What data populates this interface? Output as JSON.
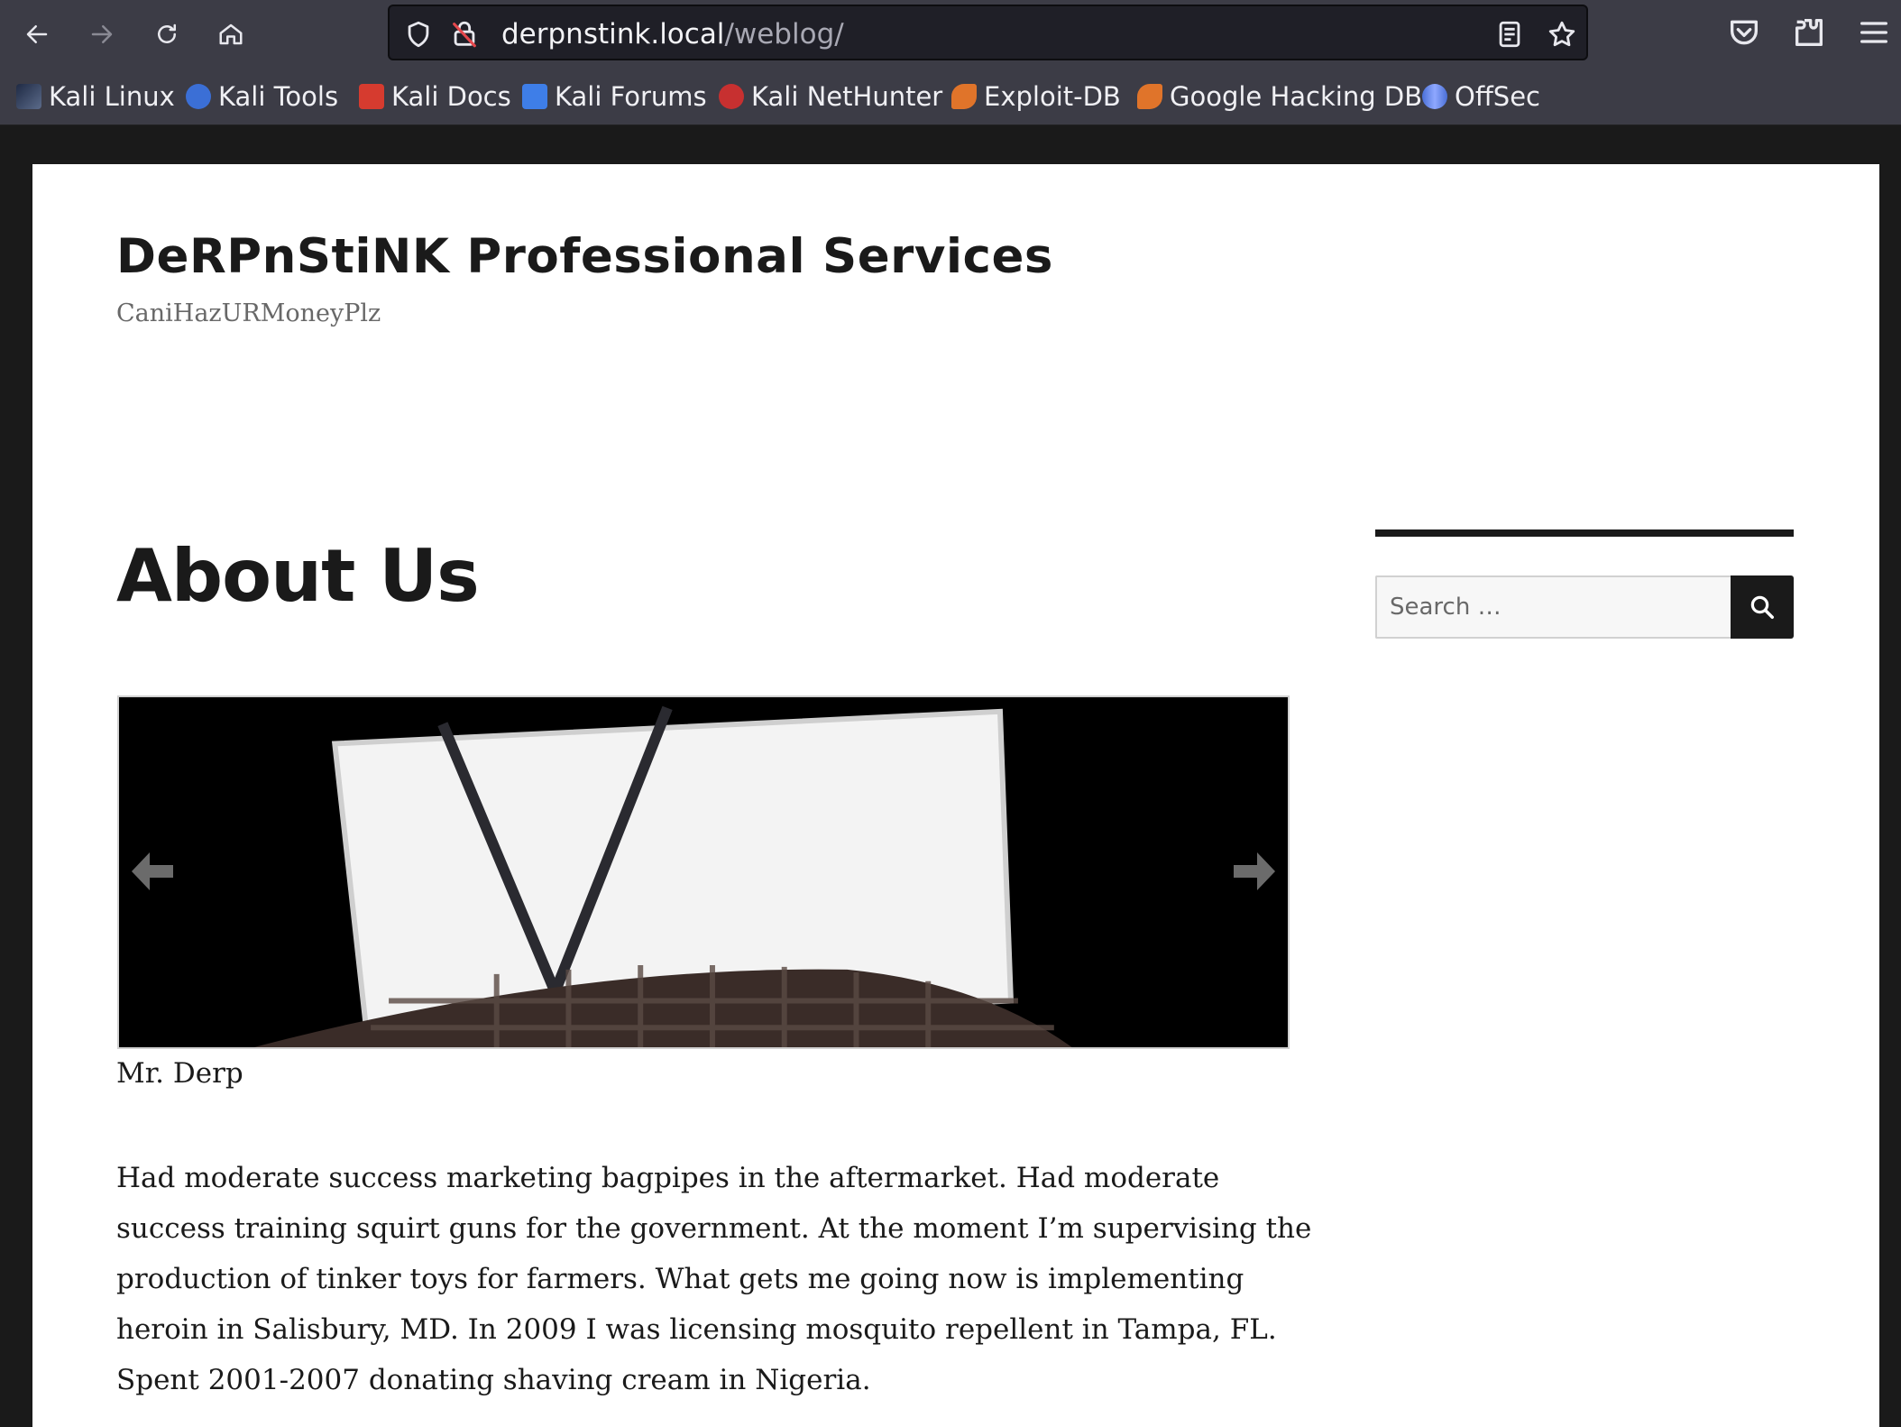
{
  "browser": {
    "url_host": "derpnstink.local",
    "url_path": "/weblog/",
    "bookmarks": [
      {
        "label": "Kali Linux",
        "icon": "kali-dragon-icon",
        "color": "#1f2a44"
      },
      {
        "label": "Kali Tools",
        "icon": "kali-tools-icon",
        "color": "#3b6fd6"
      },
      {
        "label": "Kali Docs",
        "icon": "kali-docs-icon",
        "color": "#d63b2f"
      },
      {
        "label": "Kali Forums",
        "icon": "kali-forums-icon",
        "color": "#3e7ee8"
      },
      {
        "label": "Kali NetHunter",
        "icon": "nethunter-icon",
        "color": "#c73030"
      },
      {
        "label": "Exploit-DB",
        "icon": "exploit-db-icon",
        "color": "#e0742a"
      },
      {
        "label": "Google Hacking DB",
        "icon": "ghdb-icon",
        "color": "#e0742a"
      },
      {
        "label": "OffSec",
        "icon": "offsec-icon",
        "color": "#4a6fd6"
      }
    ]
  },
  "site": {
    "title": "DeRPnStiNK Professional Services",
    "description": "CaniHazURMoneyPlz"
  },
  "post": {
    "title": "About Us",
    "image_caption": "Mr. Derp",
    "body": "Had moderate success marketing bagpipes in the aftermarket. Had moderate success training squirt guns for the government. At the moment I’m supervising the production of tinker toys for farmers. What gets me going now is implementing heroin in Salisbury, MD. In 2009 I was licensing mosquito repellent in Tampa, FL. Spent 2001-2007 donating shaving cream in Nigeria."
  },
  "sidebar": {
    "search_placeholder": "Search …"
  }
}
